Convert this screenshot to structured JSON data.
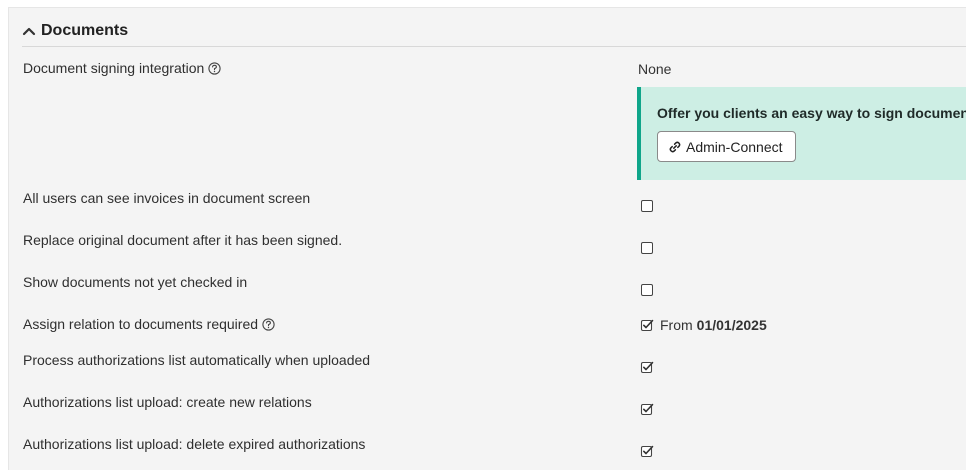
{
  "section": {
    "title": "Documents"
  },
  "rows": {
    "signing": {
      "label": "Document signing integration",
      "value": "None"
    },
    "invoices": {
      "label": "All users can see invoices in document screen",
      "checked": false
    },
    "replace": {
      "label": "Replace original document after it has been signed.",
      "checked": false
    },
    "show_unchecked": {
      "label": "Show documents not yet checked in",
      "checked": false
    },
    "assign_relation": {
      "label": "Assign relation to documents required",
      "checked": true,
      "from_label": "From",
      "from_date": "01/01/2025"
    },
    "process_auth": {
      "label": "Process authorizations list automatically when uploaded",
      "checked": true
    },
    "create_relations": {
      "label": "Authorizations list upload: create new relations",
      "checked": true
    },
    "delete_expired": {
      "label": "Authorizations list upload: delete expired authorizations",
      "checked": true
    }
  },
  "notice": {
    "text": "Offer you clients an easy way to sign documents",
    "button_label": "Admin-Connect"
  },
  "colors": {
    "accent": "#0fa58a",
    "notice_bg": "#cdeee4",
    "panel_bg": "#f4f4f4"
  }
}
